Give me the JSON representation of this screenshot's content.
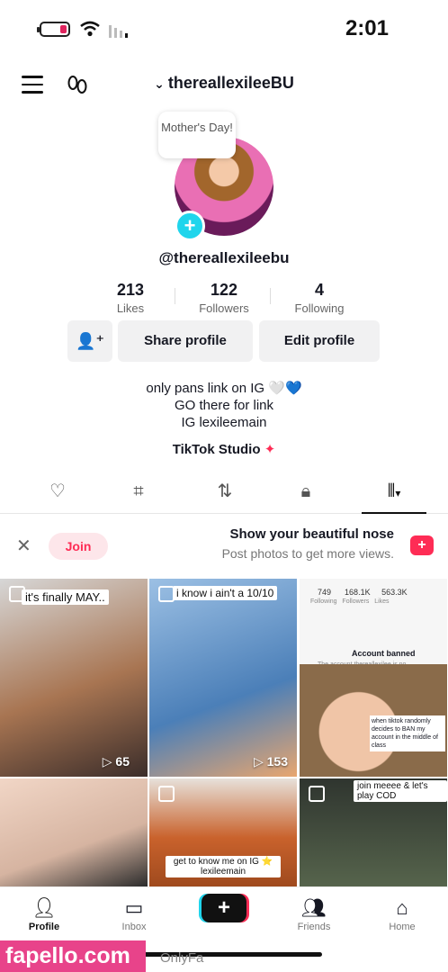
{
  "status": {
    "time": "2:01"
  },
  "header": {
    "username": "therealle​xileeBU"
  },
  "profile": {
    "bubble": "Mother's Day!",
    "handle": "@therealle​xileebu",
    "stats": [
      {
        "num": "4",
        "label": "Following"
      },
      {
        "num": "122",
        "label": "Followers"
      },
      {
        "num": "213",
        "label": "Likes"
      }
    ],
    "buttons": {
      "edit": "Edit profile",
      "share": "Share profile"
    },
    "bio": [
      "only pans link on IG 🤍💙",
      "GO there for link",
      "IG lexileemain"
    ],
    "studio": "TikTok Studio"
  },
  "banner": {
    "title": "Show your beautiful nose",
    "subtitle": "Post photos to get more views.",
    "join": "Join"
  },
  "grid": [
    {
      "caption": "",
      "views": "",
      "bg": "#f4f4f4"
    },
    {
      "caption": "i know i ain't a 10/10",
      "views": "153",
      "bg": "#5b8fc6"
    },
    {
      "caption": "it's finally MAY..",
      "views": "65",
      "bg": "#b47c4f"
    },
    {
      "caption": "join meeee & let's play COD",
      "views": "",
      "bg": "#39403a"
    },
    {
      "caption": "get to know me on IG ⭐ lexileemain",
      "views": "",
      "bg": "#c66b34"
    },
    {
      "caption": "",
      "views": "",
      "bg": "#d9b7a5"
    }
  ],
  "screenshot_tile": {
    "stats": [
      "749",
      "168.1K",
      "563.3K"
    ],
    "labels": [
      "Following",
      "Followers",
      "Likes"
    ],
    "banned_title": "Account banned",
    "banned_sub": "The account thereallexilee is no...",
    "caption": "when tiktok randomly decides to BAN my account in the middle of class"
  },
  "nav": {
    "home": "Home",
    "friends": "Friends",
    "inbox": "Inbox",
    "profile": "Profile"
  },
  "watermark": "fapello.com",
  "watermark2": "OnlyFa"
}
